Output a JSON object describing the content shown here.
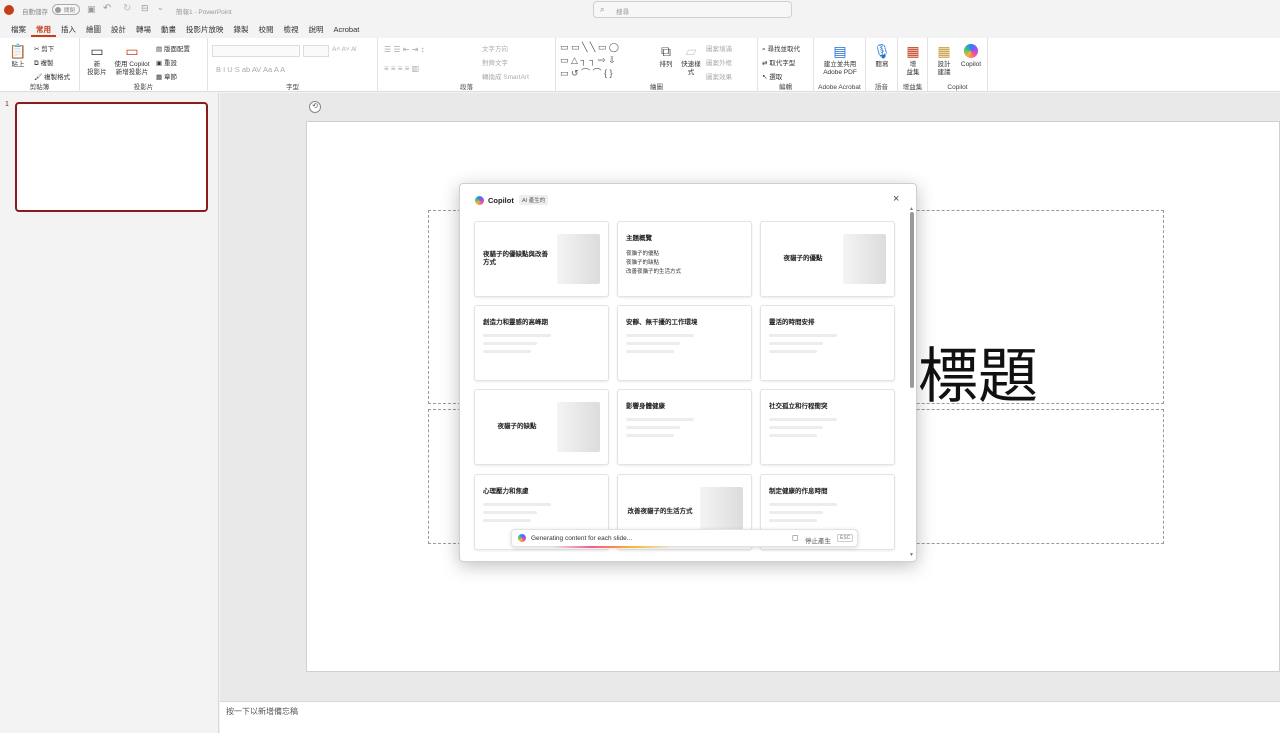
{
  "titlebar": {
    "autosave_label": "自動儲存",
    "autosave_state": "關閉",
    "doc_title": "簡報1 - PowerPoint",
    "search_placeholder": "搜尋"
  },
  "menu": [
    "檔案",
    "常用",
    "插入",
    "繪圖",
    "設計",
    "轉場",
    "動畫",
    "投影片放映",
    "錄製",
    "校閱",
    "檢視",
    "說明",
    "Acrobat"
  ],
  "menu_active": "常用",
  "ribbon": {
    "clipboard": {
      "paste": "貼上",
      "cut": "剪下",
      "copy": "複製",
      "format_painter": "複製格式",
      "label": "剪貼簿"
    },
    "slides": {
      "new_slide": "新\n投影片",
      "copilot_new": "使用 Copilot\n新增投影片",
      "layout": "版面配置",
      "reset": "重設",
      "section": "章節",
      "label": "投影片"
    },
    "font": {
      "label": "字型"
    },
    "paragraph": {
      "text_direction": "文字方向",
      "align_text": "對齊文字",
      "smartart": "轉換成 SmartArt",
      "label": "段落"
    },
    "drawing": {
      "arrange": "排列",
      "quick_styles": "快速樣式",
      "shape_fill": "圖案填滿",
      "shape_outline": "圖案外框",
      "shape_effects": "圖案效果",
      "label": "繪圖"
    },
    "editing": {
      "find": "尋找並取代",
      "replace": "取代字型",
      "select": "選取",
      "label": "編輯"
    },
    "acrobat": {
      "create_pdf": "建立並共用\nAdobe PDF",
      "label": "Adobe Acrobat"
    },
    "voice": {
      "dictate": "聽寫",
      "label": "語音"
    },
    "addins": {
      "addins": "增\n益集",
      "label": "增益集"
    },
    "copilot": {
      "designer": "設計\n建議",
      "copilot": "Copilot",
      "label": "Copilot"
    }
  },
  "thumbnail_number": "1",
  "slide": {
    "title": "標題"
  },
  "notes_placeholder": "按一下以新增備忘稿",
  "copilot_dialog": {
    "title": "Copilot",
    "badge": "AI 產生的",
    "cards": [
      {
        "title": "夜貓子的優缺點與改善方式",
        "layout": "image"
      },
      {
        "title": "主題概覽",
        "layout": "bullets",
        "bullets": [
          "夜貓子的優點",
          "夜貓子的缺點",
          "改善夜貓子的生活方式"
        ]
      },
      {
        "title": "夜貓子的優點",
        "layout": "image-center"
      },
      {
        "title": "創造力和靈感的高峰期",
        "layout": "lines"
      },
      {
        "title": "安靜、無干擾的工作環境",
        "layout": "lines"
      },
      {
        "title": "靈活的時間安排",
        "layout": "lines"
      },
      {
        "title": "夜貓子的缺點",
        "layout": "image-center"
      },
      {
        "title": "影響身體健康",
        "layout": "lines"
      },
      {
        "title": "社交孤立和行程衝突",
        "layout": "lines"
      },
      {
        "title": "心理壓力和焦慮",
        "layout": "lines"
      },
      {
        "title": "改善夜貓子的生活方式",
        "layout": "image-center"
      },
      {
        "title": "制定健康的作息時間",
        "layout": "lines"
      }
    ],
    "status_text": "Generating content for each slide...",
    "stop_label": "停止產生",
    "esc_label": "ESC"
  },
  "colors": {
    "accent": "#c43e1c",
    "thumb_border": "#8a1b1b"
  }
}
